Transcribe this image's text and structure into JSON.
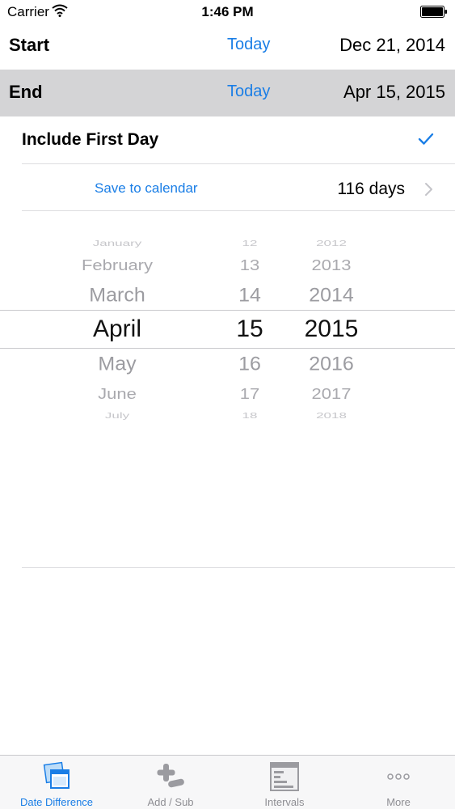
{
  "status_bar": {
    "carrier": "Carrier",
    "time": "1:46 PM"
  },
  "start_row": {
    "label": "Start",
    "today_label": "Today",
    "date": "Dec 21, 2014"
  },
  "end_row": {
    "label": "End",
    "today_label": "Today",
    "date": "Apr 15, 2015"
  },
  "include_first_day": {
    "label": "Include First Day",
    "checked": true
  },
  "save_row": {
    "link": "Save to calendar",
    "days": "116 days"
  },
  "picker": {
    "months": [
      "January",
      "February",
      "March",
      "April",
      "May",
      "June",
      "July"
    ],
    "days": [
      "12",
      "13",
      "14",
      "15",
      "16",
      "17",
      "18"
    ],
    "years": [
      "2012",
      "2013",
      "2014",
      "2015",
      "2016",
      "2017",
      "2018"
    ],
    "selected_index": 3
  },
  "tabs": [
    {
      "label": "Date Difference",
      "icon": "calendar-icon",
      "active": true
    },
    {
      "label": "Add / Sub",
      "icon": "plus-minus-icon",
      "active": false
    },
    {
      "label": "Intervals",
      "icon": "intervals-icon",
      "active": false
    },
    {
      "label": "More",
      "icon": "more-icon",
      "active": false
    }
  ],
  "colors": {
    "accent": "#1a7ee6",
    "selected_row_bg": "#d4d4d6",
    "tab_inactive": "#8e8e93"
  }
}
